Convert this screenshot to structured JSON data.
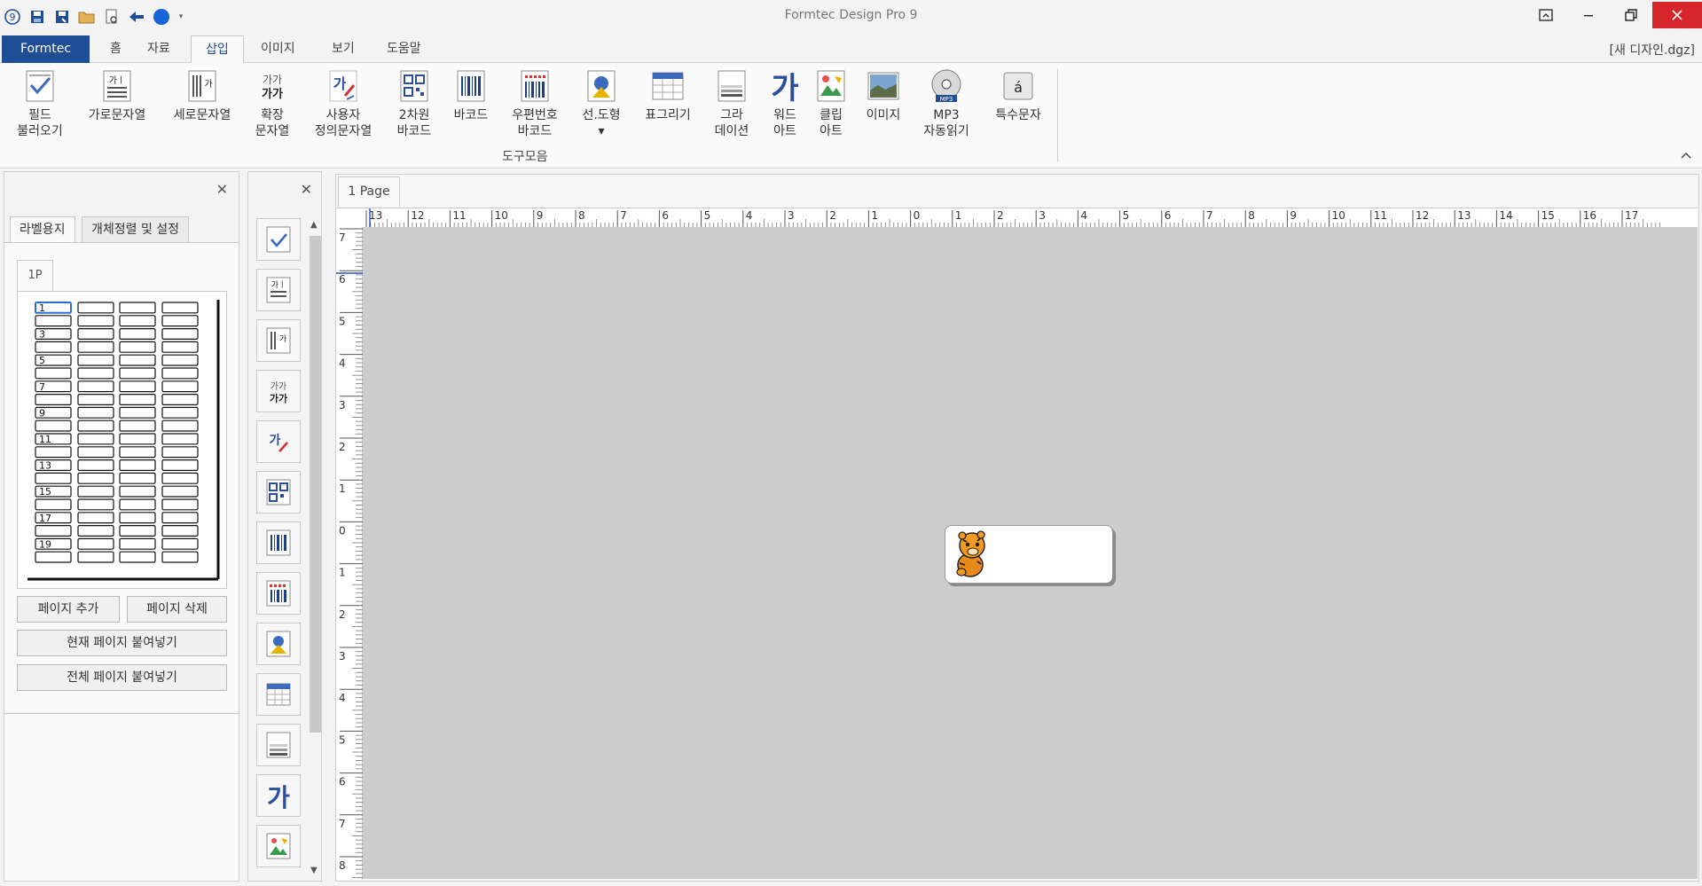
{
  "window": {
    "title": "Formtec Design Pro 9",
    "document_name": "[새 디자인.dgz]"
  },
  "tabs": [
    {
      "label": "Formtec"
    },
    {
      "label": "홈"
    },
    {
      "label": "자료"
    },
    {
      "label": "삽입"
    },
    {
      "label": "이미지"
    },
    {
      "label": "보기"
    },
    {
      "label": "도움말"
    }
  ],
  "active_tab": "삽입",
  "ribbon": {
    "group_label": "도구모음",
    "buttons": [
      {
        "label": "필드\n불러오기",
        "icon": "field-load-icon"
      },
      {
        "label": "가로문자열",
        "icon": "horizontal-text-icon"
      },
      {
        "label": "세로문자열",
        "icon": "vertical-text-icon"
      },
      {
        "label": "확장\n문자열",
        "icon": "extended-text-icon"
      },
      {
        "label": "사용자\n정의문자열",
        "icon": "custom-text-icon"
      },
      {
        "label": "2차원\n바코드",
        "icon": "qr-code-icon"
      },
      {
        "label": "바코드",
        "icon": "barcode-icon"
      },
      {
        "label": "우편번호\n바코드",
        "icon": "postal-barcode-icon"
      },
      {
        "label": "선.도형\n▾",
        "icon": "shape-icon"
      },
      {
        "label": "표그리기",
        "icon": "table-icon"
      },
      {
        "label": "그라\n데이션",
        "icon": "gradation-icon"
      },
      {
        "label": "워드\n아트",
        "icon": "word-art-icon"
      },
      {
        "label": "클립\n아트",
        "icon": "clip-art-icon"
      },
      {
        "label": "이미지",
        "icon": "image-icon"
      },
      {
        "label": "MP3\n자동읽기",
        "icon": "mp3-icon"
      },
      {
        "label": "특수문자",
        "icon": "special-char-icon"
      }
    ]
  },
  "left_panel": {
    "tabs": [
      "라벨용지",
      "개체정렬 및 설정"
    ],
    "page_tab": "1P",
    "sheet_row_numbers": [
      "1",
      "3",
      "5",
      "7",
      "9",
      "11",
      "13",
      "15",
      "17",
      "19"
    ],
    "buttons": {
      "add_page": "페이지 추가",
      "delete_page": "페이지 삭제",
      "paste_current": "현재 페이지 붙여넣기",
      "paste_all": "전체 페이지 붙여넣기"
    }
  },
  "canvas": {
    "page_tab": "1 Page",
    "h_ruler_labels": [
      "13",
      "12",
      "11",
      "10",
      "9",
      "8",
      "7",
      "6",
      "5",
      "4",
      "3",
      "2",
      "1",
      "0",
      "1",
      "2",
      "3",
      "4",
      "5",
      "6",
      "7",
      "8",
      "9",
      "10",
      "11",
      "12",
      "13",
      "14",
      "15",
      "16",
      "17"
    ],
    "v_ruler_labels": [
      "7",
      "6",
      "5",
      "4",
      "3",
      "2",
      "1",
      "0",
      "1",
      "2",
      "3",
      "4",
      "5",
      "6",
      "7",
      "8"
    ]
  },
  "colors": {
    "accent": "#1f4e96",
    "close_button": "#d8262d",
    "canvas": "#cccccc"
  }
}
